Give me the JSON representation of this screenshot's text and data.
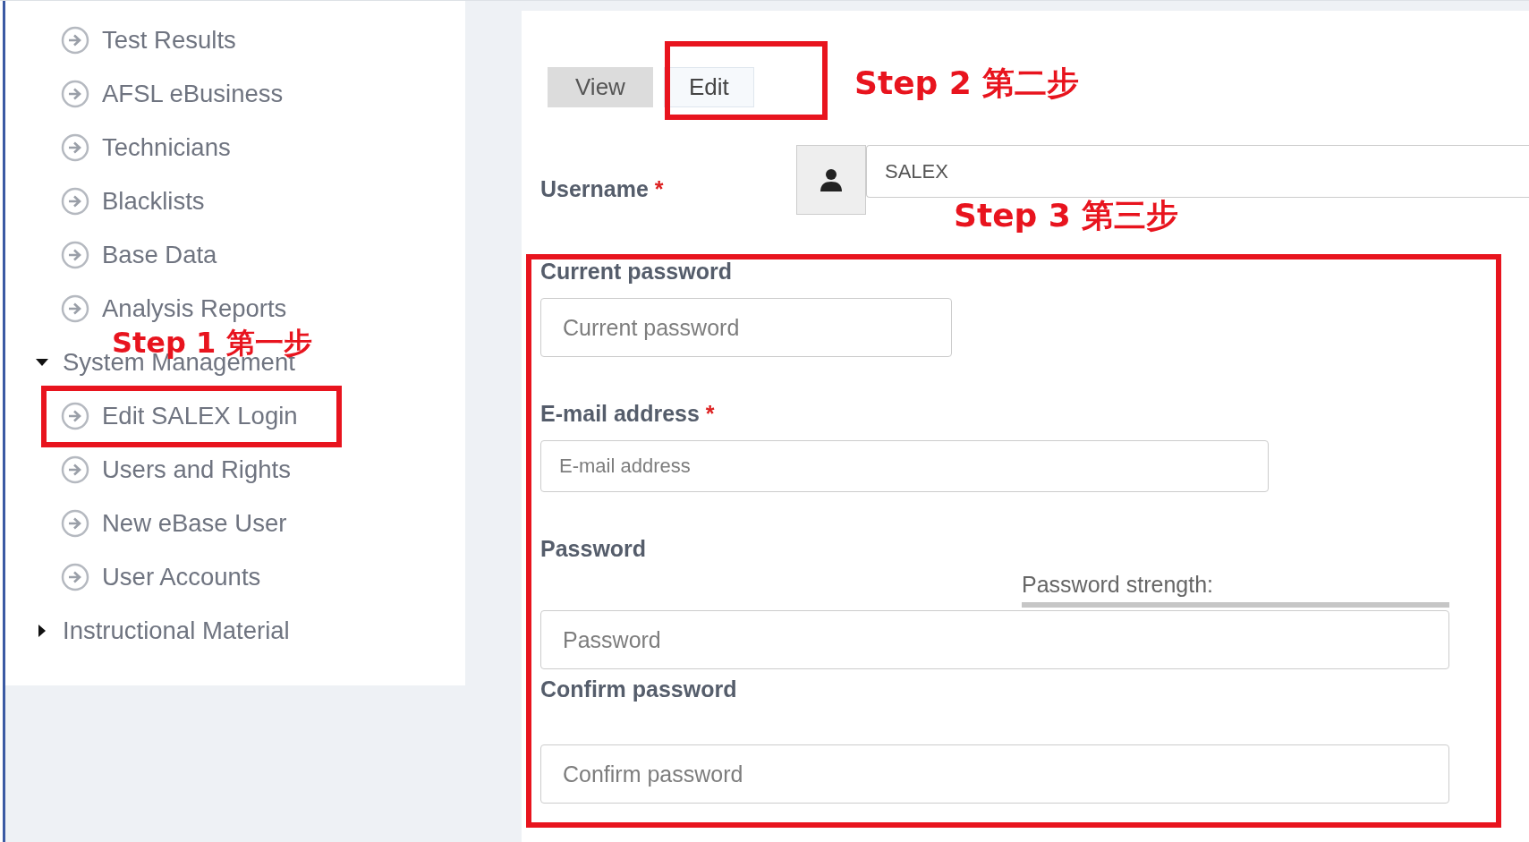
{
  "sidebar": {
    "items": [
      {
        "label": "Test Results"
      },
      {
        "label": "AFSL eBusiness"
      },
      {
        "label": "Technicians"
      },
      {
        "label": "Blacklists"
      },
      {
        "label": "Base Data"
      },
      {
        "label": "Analysis Reports"
      },
      {
        "label": "System Management",
        "expanded": true,
        "children": [
          {
            "label": "Edit SALEX Login"
          },
          {
            "label": "Users and Rights"
          },
          {
            "label": "New eBase User"
          },
          {
            "label": "User Accounts"
          }
        ]
      },
      {
        "label": "Instructional Material",
        "expanded": false
      }
    ]
  },
  "tabs": [
    {
      "label": "View",
      "selected": false
    },
    {
      "label": "Edit",
      "selected": true
    }
  ],
  "form": {
    "fields": [
      {
        "kind": "username",
        "label": "Username",
        "required_mark": "*",
        "value": "SALEX"
      },
      {
        "kind": "short",
        "label": "Current password",
        "placeholder": "Current password"
      },
      {
        "kind": "medium",
        "label": "E-mail address",
        "required_mark": "*",
        "placeholder": "E-mail address"
      },
      {
        "kind": "strength",
        "label": "Password",
        "strength_label": "Password strength:",
        "placeholder": "Password"
      },
      {
        "kind": "confirm",
        "label": "Confirm password",
        "placeholder": "Confirm password"
      }
    ]
  },
  "annotations": [
    {
      "text": "Step 1 第一步"
    },
    {
      "text": "Step 2 第二步"
    },
    {
      "text": "Step 3 第三步"
    }
  ]
}
